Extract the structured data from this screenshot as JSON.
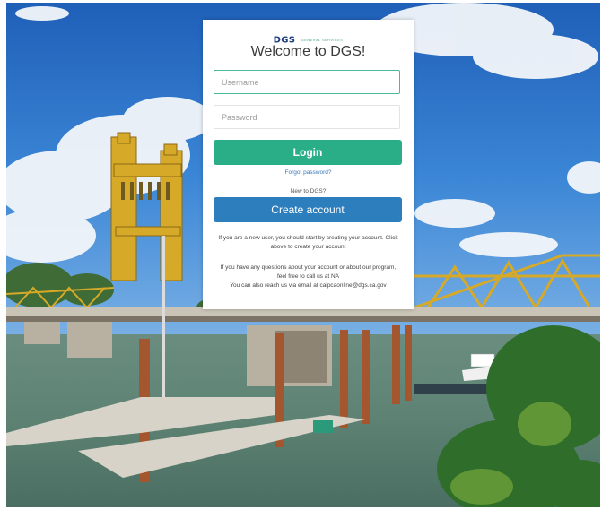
{
  "brand": {
    "logo_text": "DGS",
    "logo_subtext": "GENERAL SERVICES"
  },
  "login": {
    "title": "Welcome to DGS!",
    "username_placeholder": "Username",
    "password_placeholder": "Password",
    "login_label": "Login",
    "forgot_password_label": "Forgot password?",
    "new_user_prompt": "New to DGS?",
    "create_account_label": "Create account",
    "info_new_user": "If you are a new user, you should start by creating your account. Click above to create your account",
    "info_questions": "If you have any questions about your account or about our program, feel free to call us at NA",
    "info_email": "You can also reach us via email at calpcaonline@dgs.ca.gov"
  },
  "colors": {
    "login_button": "#2aae87",
    "create_button": "#2c7ebd",
    "focus_border": "#4bb89a",
    "bridge": "#d6a928",
    "sky": "#2f6fc4"
  }
}
